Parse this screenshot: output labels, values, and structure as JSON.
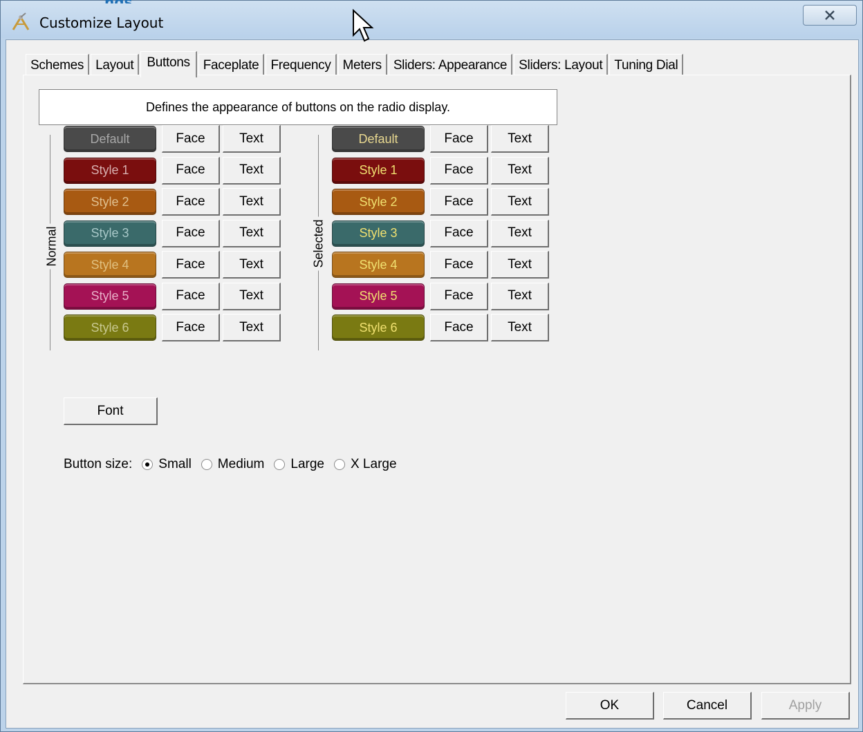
{
  "window": {
    "title": "Customize Layout",
    "title_ghost": "ngs"
  },
  "tabs": [
    {
      "label": "Schemes",
      "active": false
    },
    {
      "label": "Layout",
      "active": false
    },
    {
      "label": "Buttons",
      "active": true
    },
    {
      "label": "Faceplate",
      "active": false
    },
    {
      "label": "Frequency",
      "active": false
    },
    {
      "label": "Meters",
      "active": false
    },
    {
      "label": "Sliders: Appearance",
      "active": false
    },
    {
      "label": "Sliders: Layout",
      "active": false
    },
    {
      "label": "Tuning Dial",
      "active": false
    }
  ],
  "description": "Defines the appearance of buttons on the radio display.",
  "groups": {
    "normal_label": "Normal",
    "selected_label": "Selected"
  },
  "styles": [
    {
      "label": "Default",
      "bg": "#4a4a4a",
      "normal_fg": "#a8a8a8",
      "selected_fg": "#e8d890"
    },
    {
      "label": "Style 1",
      "bg": "#7a0e0e",
      "normal_fg": "#d8b0b0",
      "selected_fg": "#f0e070"
    },
    {
      "label": "Style 2",
      "bg": "#a85a12",
      "normal_fg": "#e0c090",
      "selected_fg": "#f0e070"
    },
    {
      "label": "Style 3",
      "bg": "#3a6a6a",
      "normal_fg": "#a8c8c8",
      "selected_fg": "#f0e070"
    },
    {
      "label": "Style 4",
      "bg": "#b8751f",
      "normal_fg": "#e0c080",
      "selected_fg": "#f0e070"
    },
    {
      "label": "Style 5",
      "bg": "#a41255",
      "normal_fg": "#e8b0c8",
      "selected_fg": "#f0e070"
    },
    {
      "label": "Style 6",
      "bg": "#7a7a12",
      "normal_fg": "#c8c890",
      "selected_fg": "#f0e070"
    }
  ],
  "face_label": "Face",
  "text_label": "Text",
  "font_label": "Font",
  "button_size": {
    "label": "Button size:",
    "options": [
      "Small",
      "Medium",
      "Large",
      "X Large"
    ],
    "selected": "Small"
  },
  "footer": {
    "ok": "OK",
    "cancel": "Cancel",
    "apply": "Apply"
  },
  "icons": {
    "app": "radio-tower-icon",
    "close": "close-icon",
    "cursor": "mouse-cursor-icon"
  }
}
